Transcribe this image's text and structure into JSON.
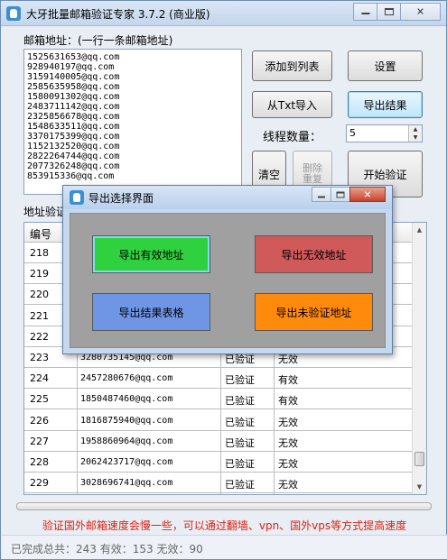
{
  "window": {
    "title": "大牙批量邮箱验证专家 3.7.2 (商业版)",
    "minimize_glyph": "—",
    "restore_glyph": "□",
    "close_glyph": "✕"
  },
  "mail_input": {
    "label": "邮箱地址：(一行一条邮箱地址)",
    "lines": [
      "1525631653@qq.com",
      "928940197@qq.com",
      "3159140005@qq.com",
      "2585635958@qq.com",
      "1580091302@qq.com",
      "2483711142@qq.com",
      "2325856678@qq.com",
      "1548633511@qq.com",
      "3370175399@qq.com",
      "1152132520@qq.com",
      "2822264744@qq.com",
      "2077326248@qq.com",
      "853915336@qq.com"
    ]
  },
  "buttons": {
    "add_to_list": "添加到列表",
    "settings": "设置",
    "import_txt": "从Txt导入",
    "export_results": "导出结果",
    "clear": "清空",
    "delete_duplicates": "删除\n重复",
    "start_verify": "开始验证"
  },
  "thread_count": {
    "label": "线程数量：",
    "value": "5"
  },
  "results": {
    "label": "地址验证",
    "columns": [
      "编号"
    ],
    "rows": [
      {
        "id": "218",
        "email": "",
        "status": "",
        "result": ""
      },
      {
        "id": "219",
        "email": "",
        "status": "",
        "result": ""
      },
      {
        "id": "220",
        "email": "",
        "status": "",
        "result": ""
      },
      {
        "id": "221",
        "email": "",
        "status": "",
        "result": ""
      },
      {
        "id": "222",
        "email": "",
        "status": "",
        "result": ""
      },
      {
        "id": "223",
        "email": "3280735145@qq.com",
        "status": "已验证",
        "result": "无效"
      },
      {
        "id": "224",
        "email": "2457280676@qq.com",
        "status": "已验证",
        "result": "有效"
      },
      {
        "id": "225",
        "email": "1850487460@qq.com",
        "status": "已验证",
        "result": "有效"
      },
      {
        "id": "226",
        "email": "1816875940@qq.com",
        "status": "已验证",
        "result": "无效"
      },
      {
        "id": "227",
        "email": "1958860964@qq.com",
        "status": "已验证",
        "result": "无效"
      },
      {
        "id": "228",
        "email": "2062423717@qq.com",
        "status": "已验证",
        "result": "无效"
      },
      {
        "id": "229",
        "email": "3028696741@qq.com",
        "status": "已验证",
        "result": "无效"
      }
    ]
  },
  "notice": "验证国外邮箱速度会慢一些，可以通过翻墙、vpn、国外vps等方式提高速度",
  "status_bar": "已完成总共：243  有效：153  无效：90",
  "dialog": {
    "title": "导出选择界面",
    "export_valid": "导出有效地址",
    "export_invalid": "导出无效地址",
    "export_table": "导出结果表格",
    "export_unverified": "导出未验证地址",
    "close_glyph": "✕"
  },
  "colors": {
    "export_valid": "#2fd23e",
    "export_invalid": "#d0595a",
    "export_table": "#6f95e5",
    "export_unverified": "#ff8a0c",
    "notice": "#e0200f"
  }
}
